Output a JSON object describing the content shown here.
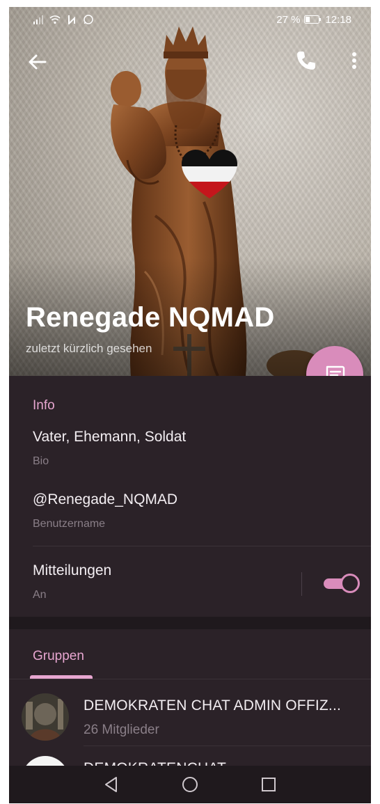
{
  "status_bar": {
    "battery": "27 %",
    "time": "12:18"
  },
  "profile": {
    "name": "Renegade NQMAD",
    "last_seen": "zuletzt kürzlich gesehen"
  },
  "info": {
    "title": "Info",
    "bio_value": "Vater, Ehemann, Soldat",
    "bio_label": "Bio",
    "username_value": "@Renegade_NQMAD",
    "username_label": "Benutzername",
    "notifications_label": "Mitteilungen",
    "notifications_state": "An",
    "notifications_on": true
  },
  "groups": {
    "tab_label": "Gruppen",
    "items": [
      {
        "name": "DEMOKRATEN CHAT ADMIN OFFIZ...",
        "members": "26 Mitglieder"
      },
      {
        "name": "DEMOKRATENCHAT",
        "members": ""
      }
    ]
  },
  "colors": {
    "accent": "#d98cbb",
    "accent_text": "#e7a6d0",
    "background": "#2b2228"
  },
  "icons": {
    "back": "arrow-left-icon",
    "call": "phone-icon",
    "more": "more-vertical-icon",
    "fab": "message-icon"
  }
}
